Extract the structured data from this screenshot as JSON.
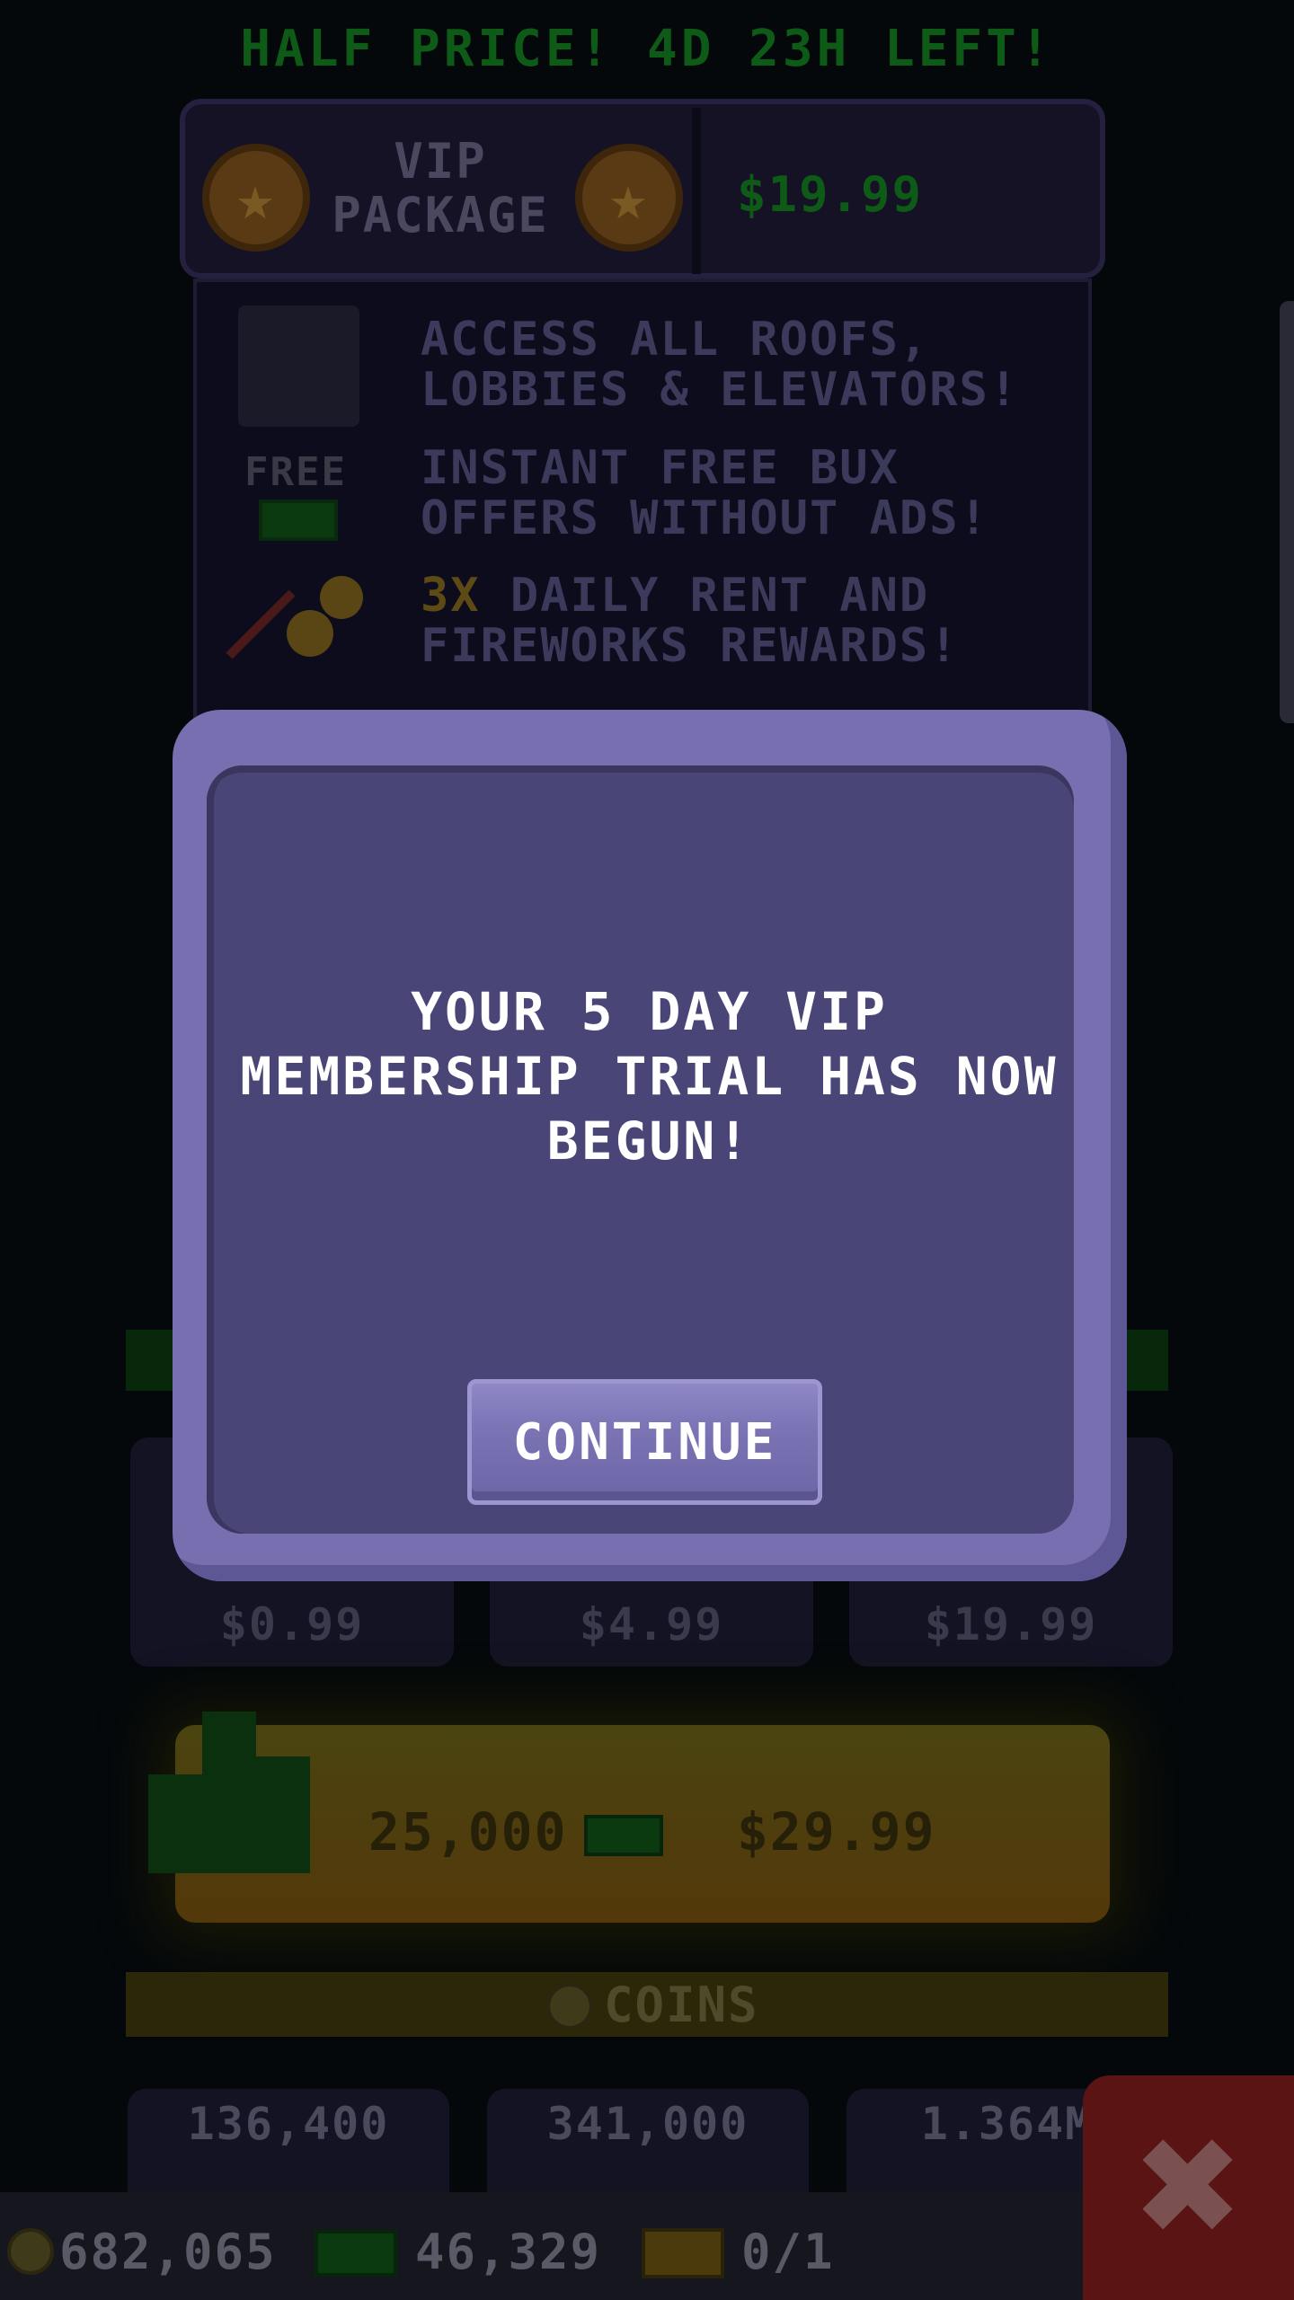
{
  "banner": {
    "text": "HALF PRICE! 4D 23H LEFT!"
  },
  "vip_package": {
    "title_line1": "VIP",
    "title_line2": "PACKAGE",
    "price": "$19.99",
    "perks": [
      {
        "line1": "ACCESS ALL ROOFS,",
        "line2": "LOBBIES & ELEVATORS!"
      },
      {
        "line1": "INSTANT FREE BUX",
        "line2": "OFFERS WITHOUT ADS!"
      },
      {
        "highlight": "3X",
        "line1_rest": " DAILY RENT AND",
        "line2": "FIREWORKS REWARDS!"
      }
    ],
    "free_label": "FREE"
  },
  "bux_price_cards": [
    "$0.99",
    "$4.99",
    "$19.99"
  ],
  "featured_offer": {
    "amount": "25,000",
    "price": "$29.99"
  },
  "coins_section": {
    "label": "COINS",
    "cards": [
      "136,400",
      "341,000",
      "1.364M"
    ]
  },
  "bottom_bar": {
    "coins": "682,065",
    "bux": "46,329",
    "tickets": "0/1"
  },
  "modal": {
    "message": "YOUR 5 DAY VIP MEMBERSHIP TRIAL HAS NOW BEGUN!",
    "button_label": "CONTINUE"
  },
  "colors": {
    "modal_frame": "#776fb0",
    "modal_inner": "#4a4577",
    "button": "#7a73b4",
    "banner_green": "#0e5a17",
    "close_red": "#5a1414"
  },
  "icons": [
    "star-icon",
    "roof-icon",
    "cash-icon",
    "rocket-icon",
    "coin-icon",
    "ticket-icon",
    "close-icon"
  ]
}
